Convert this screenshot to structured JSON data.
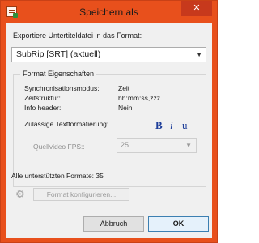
{
  "window": {
    "title": "Speichern als",
    "close_label": "✕"
  },
  "export": {
    "label": "Exportiere Untertiteldatei in das Format:",
    "selected_format": "SubRip [SRT] (aktuell)"
  },
  "properties": {
    "group_title": "Format Eigenschaften",
    "rows": [
      {
        "label": "Synchronisationsmodus:",
        "value": "Zeit"
      },
      {
        "label": "Zeitstruktur:",
        "value": "hh:mm:ss,zzz"
      },
      {
        "label": "Info header:",
        "value": "Nein"
      }
    ],
    "text_formatting_label": "Zulässige Textformatierung:",
    "format_icons": {
      "bold": "B",
      "italic": "i",
      "underline": "u"
    },
    "fps_label": "Quellvideo FPS::",
    "fps_value": "25"
  },
  "all_formats_text": "Alle unterstützten Formate: 35",
  "configure_button": "Format konfigurieren...",
  "buttons": {
    "cancel": "Abbruch",
    "ok": "OK"
  },
  "colors": {
    "title_bar": "#e8501c",
    "close_button": "#c7391c",
    "format_icon": "#1d3d99"
  }
}
